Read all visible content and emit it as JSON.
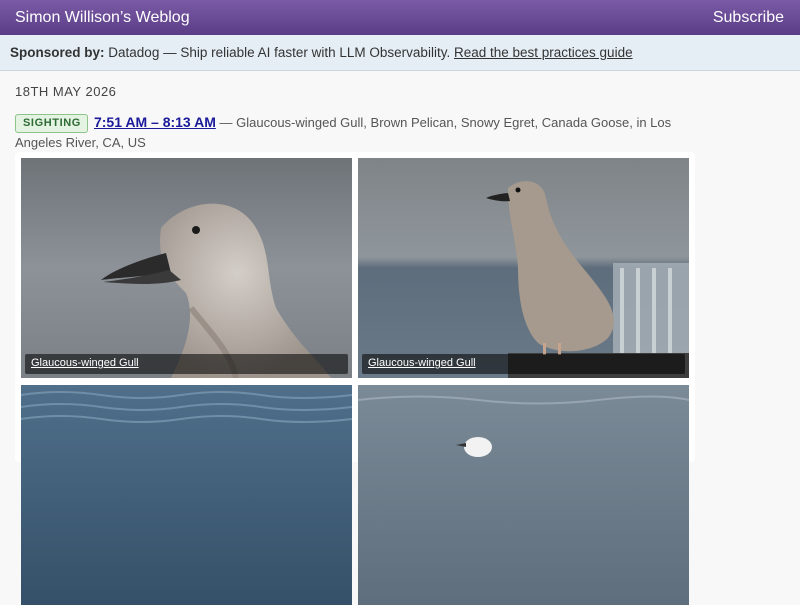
{
  "header": {
    "site_title": "Simon Willison’s Weblog",
    "subscribe_label": "Subscribe"
  },
  "sponsor": {
    "label": "Sponsored by:",
    "text": "Datadog — Ship reliable AI faster with LLM Observability.",
    "link_text": "Read the best practices guide"
  },
  "date": "18TH MAY 2026",
  "entry": {
    "badge": "SIGHTING",
    "time_range": "7:51 AM – 8:13 AM",
    "separator": "—",
    "species_location": "Glaucous-winged Gull, Brown Pelican, Snowy Egret, Canada Goose, in Los Angeles River, CA, US"
  },
  "photos": [
    {
      "caption": "Glaucous-winged Gull"
    },
    {
      "caption": "Glaucous-winged Gull"
    },
    {
      "caption": ""
    },
    {
      "caption": ""
    }
  ],
  "colors": {
    "header_purple": "#5b3d86",
    "sponsor_bg": "#e6eef5",
    "badge_green": "#2e6b35",
    "link_blue": "#1a1a9a"
  }
}
